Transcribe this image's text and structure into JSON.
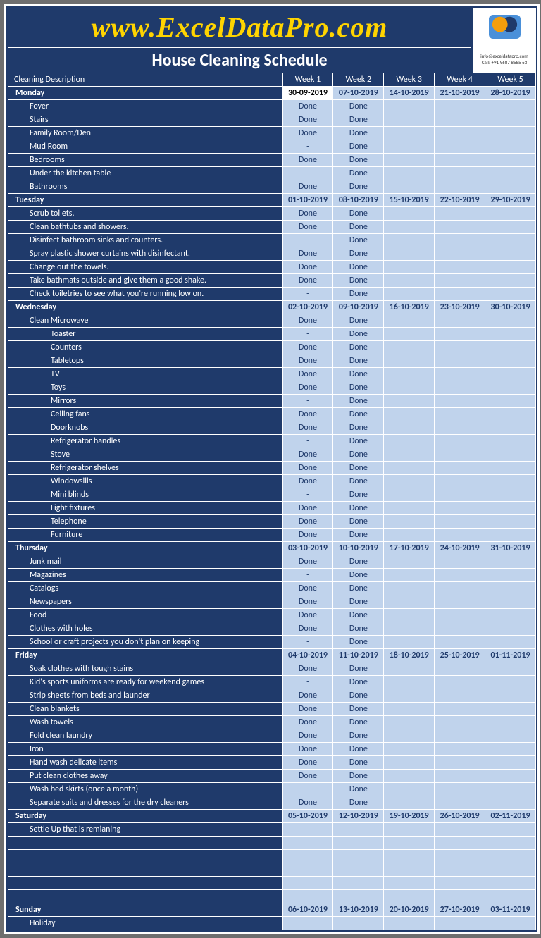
{
  "brand": "www.ExcelDataPro.com",
  "title": "House Cleaning Schedule",
  "contact": {
    "email": "info@exceldatapro.com",
    "phone": "Call: +91 9687 8585 63"
  },
  "headers": {
    "desc": "Cleaning Description",
    "weeks": [
      "Week 1",
      "Week 2",
      "Week 3",
      "Week 4",
      "Week 5"
    ]
  },
  "days": [
    {
      "name": "Monday",
      "dates": [
        "30-09-2019",
        "07-10-2019",
        "14-10-2019",
        "21-10-2019",
        "28-10-2019"
      ],
      "today": 0,
      "tasks": [
        {
          "t": "Foyer",
          "s": [
            "Done",
            "Done",
            "",
            "",
            ""
          ]
        },
        {
          "t": "Stairs",
          "s": [
            "Done",
            "Done",
            "",
            "",
            ""
          ]
        },
        {
          "t": "Family Room/Den",
          "s": [
            "Done",
            "Done",
            "",
            "",
            ""
          ]
        },
        {
          "t": "Mud Room",
          "s": [
            "-",
            "Done",
            "",
            "",
            ""
          ]
        },
        {
          "t": "Bedrooms",
          "s": [
            "Done",
            "Done",
            "",
            "",
            ""
          ]
        },
        {
          "t": "Under the kitchen table",
          "s": [
            "-",
            "Done",
            "",
            "",
            ""
          ]
        },
        {
          "t": "Bathrooms",
          "s": [
            "Done",
            "Done",
            "",
            "",
            ""
          ]
        }
      ]
    },
    {
      "name": "Tuesday",
      "dates": [
        "01-10-2019",
        "08-10-2019",
        "15-10-2019",
        "22-10-2019",
        "29-10-2019"
      ],
      "tasks": [
        {
          "t": "Scrub toilets.",
          "s": [
            "Done",
            "Done",
            "",
            "",
            ""
          ]
        },
        {
          "t": "Clean bathtubs and showers.",
          "s": [
            "Done",
            "Done",
            "",
            "",
            ""
          ]
        },
        {
          "t": "Disinfect bathroom sinks and counters.",
          "s": [
            "-",
            "Done",
            "",
            "",
            ""
          ]
        },
        {
          "t": "Spray plastic shower curtains with disinfectant.",
          "s": [
            "Done",
            "Done",
            "",
            "",
            ""
          ]
        },
        {
          "t": "Change out the towels.",
          "s": [
            "Done",
            "Done",
            "",
            "",
            ""
          ]
        },
        {
          "t": "Take bathmats outside and give them a good shake.",
          "s": [
            "Done",
            "Done",
            "",
            "",
            ""
          ]
        },
        {
          "t": "Check toiletries to see what you're running low on.",
          "s": [
            "-",
            "Done",
            "",
            "",
            ""
          ]
        }
      ]
    },
    {
      "name": "Wednesday",
      "dates": [
        "02-10-2019",
        "09-10-2019",
        "16-10-2019",
        "23-10-2019",
        "30-10-2019"
      ],
      "tasks": [
        {
          "t": "Clean Microwave",
          "s": [
            "Done",
            "Done",
            "",
            "",
            ""
          ]
        },
        {
          "t": "Toaster",
          "s": [
            "-",
            "Done",
            "",
            "",
            ""
          ],
          "i": 2
        },
        {
          "t": "Counters",
          "s": [
            "Done",
            "Done",
            "",
            "",
            ""
          ],
          "i": 2
        },
        {
          "t": "Tabletops",
          "s": [
            "Done",
            "Done",
            "",
            "",
            ""
          ],
          "i": 2
        },
        {
          "t": "TV",
          "s": [
            "Done",
            "Done",
            "",
            "",
            ""
          ],
          "i": 2
        },
        {
          "t": "Toys",
          "s": [
            "Done",
            "Done",
            "",
            "",
            ""
          ],
          "i": 2
        },
        {
          "t": "Mirrors",
          "s": [
            "-",
            "Done",
            "",
            "",
            ""
          ],
          "i": 2
        },
        {
          "t": "Ceiling fans",
          "s": [
            "Done",
            "Done",
            "",
            "",
            ""
          ],
          "i": 2
        },
        {
          "t": "Doorknobs",
          "s": [
            "Done",
            "Done",
            "",
            "",
            ""
          ],
          "i": 2
        },
        {
          "t": "Refrigerator handles",
          "s": [
            "-",
            "Done",
            "",
            "",
            ""
          ],
          "i": 2
        },
        {
          "t": "Stove",
          "s": [
            "Done",
            "Done",
            "",
            "",
            ""
          ],
          "i": 2
        },
        {
          "t": "Refrigerator shelves",
          "s": [
            "Done",
            "Done",
            "",
            "",
            ""
          ],
          "i": 2
        },
        {
          "t": "Windowsills",
          "s": [
            "Done",
            "Done",
            "",
            "",
            ""
          ],
          "i": 2
        },
        {
          "t": "Mini blinds",
          "s": [
            "-",
            "Done",
            "",
            "",
            ""
          ],
          "i": 2
        },
        {
          "t": "Light fixtures",
          "s": [
            "Done",
            "Done",
            "",
            "",
            ""
          ],
          "i": 2
        },
        {
          "t": "Telephone",
          "s": [
            "Done",
            "Done",
            "",
            "",
            ""
          ],
          "i": 2
        },
        {
          "t": "Furniture",
          "s": [
            "Done",
            "Done",
            "",
            "",
            ""
          ],
          "i": 2
        }
      ]
    },
    {
      "name": "Thursday",
      "dates": [
        "03-10-2019",
        "10-10-2019",
        "17-10-2019",
        "24-10-2019",
        "31-10-2019"
      ],
      "tasks": [
        {
          "t": "Junk mail",
          "s": [
            "Done",
            "Done",
            "",
            "",
            ""
          ]
        },
        {
          "t": "Magazines",
          "s": [
            "-",
            "Done",
            "",
            "",
            ""
          ]
        },
        {
          "t": "Catalogs",
          "s": [
            "Done",
            "Done",
            "",
            "",
            ""
          ]
        },
        {
          "t": "Newspapers",
          "s": [
            "Done",
            "Done",
            "",
            "",
            ""
          ]
        },
        {
          "t": "Food",
          "s": [
            "Done",
            "Done",
            "",
            "",
            ""
          ]
        },
        {
          "t": "Clothes with holes",
          "s": [
            "Done",
            "Done",
            "",
            "",
            ""
          ]
        },
        {
          "t": "School or craft projects you don't plan on keeping",
          "s": [
            "-",
            "Done",
            "",
            "",
            ""
          ]
        }
      ]
    },
    {
      "name": "Friday",
      "dates": [
        "04-10-2019",
        "11-10-2019",
        "18-10-2019",
        "25-10-2019",
        "01-11-2019"
      ],
      "tasks": [
        {
          "t": "Soak clothes with tough stains",
          "s": [
            "Done",
            "Done",
            "",
            "",
            ""
          ]
        },
        {
          "t": "Kid's sports uniforms are ready for weekend games",
          "s": [
            "-",
            "Done",
            "",
            "",
            ""
          ]
        },
        {
          "t": "Strip sheets from beds and launder",
          "s": [
            "Done",
            "Done",
            "",
            "",
            ""
          ]
        },
        {
          "t": "Clean blankets",
          "s": [
            "Done",
            "Done",
            "",
            "",
            ""
          ]
        },
        {
          "t": "Wash towels",
          "s": [
            "Done",
            "Done",
            "",
            "",
            ""
          ]
        },
        {
          "t": "Fold clean laundry",
          "s": [
            "Done",
            "Done",
            "",
            "",
            ""
          ]
        },
        {
          "t": "Iron",
          "s": [
            "Done",
            "Done",
            "",
            "",
            ""
          ]
        },
        {
          "t": "Hand wash delicate items",
          "s": [
            "Done",
            "Done",
            "",
            "",
            ""
          ]
        },
        {
          "t": "Put clean clothes away",
          "s": [
            "Done",
            "Done",
            "",
            "",
            ""
          ]
        },
        {
          "t": "Wash bed skirts (once a month)",
          "s": [
            "-",
            "Done",
            "",
            "",
            ""
          ]
        },
        {
          "t": "Separate suits and dresses for the dry cleaners",
          "s": [
            "Done",
            "Done",
            "",
            "",
            ""
          ]
        }
      ]
    },
    {
      "name": "Saturday",
      "dates": [
        "05-10-2019",
        "12-10-2019",
        "19-10-2019",
        "26-10-2019",
        "02-11-2019"
      ],
      "tasks": [
        {
          "t": "Settle Up that is remianing",
          "s": [
            "-",
            "-",
            "",
            "",
            ""
          ]
        }
      ],
      "blanks": 5
    },
    {
      "name": "Sunday",
      "dates": [
        "06-10-2019",
        "13-10-2019",
        "20-10-2019",
        "27-10-2019",
        "03-11-2019"
      ],
      "tasks": [
        {
          "t": "Holiday",
          "s": [
            "",
            "",
            "",
            "",
            ""
          ]
        }
      ]
    }
  ]
}
